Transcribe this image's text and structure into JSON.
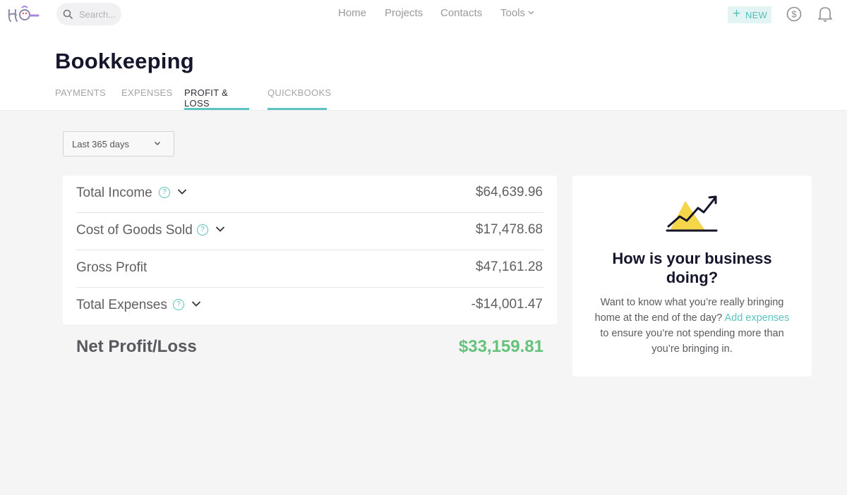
{
  "topbar": {
    "search_placeholder": "Search...",
    "nav": [
      "Home",
      "Projects",
      "Contacts",
      "Tools"
    ],
    "new_label": "NEW"
  },
  "header": {
    "title": "Bookkeeping",
    "tabs": [
      "PAYMENTS",
      "EXPENSES",
      "PROFIT & LOSS",
      "QUICKBOOKS"
    ],
    "active_tab": "PROFIT & LOSS"
  },
  "filter": {
    "selected": "Last 365 days"
  },
  "summary": {
    "rows": [
      {
        "label": "Total Income",
        "amount": "$64,639.96"
      },
      {
        "label": "Cost of Goods Sold",
        "amount": "$17,478.68"
      },
      {
        "label": "Gross Profit",
        "amount": "$47,161.28"
      },
      {
        "label": "Total Expenses",
        "amount": "-$14,001.47"
      }
    ],
    "net_label": "Net Profit/Loss",
    "net_amount": "$33,159.81"
  },
  "side": {
    "heading": "How is your business doing?",
    "text_before": "Want to know what you’re really bringing home at the end of the day? ",
    "link": "Add expenses",
    "text_after": " to ensure you’re not spending more than you’re bringing in."
  },
  "colors": {
    "accent": "#5bc3c0",
    "positive": "#64c27b",
    "title": "#15152b"
  }
}
